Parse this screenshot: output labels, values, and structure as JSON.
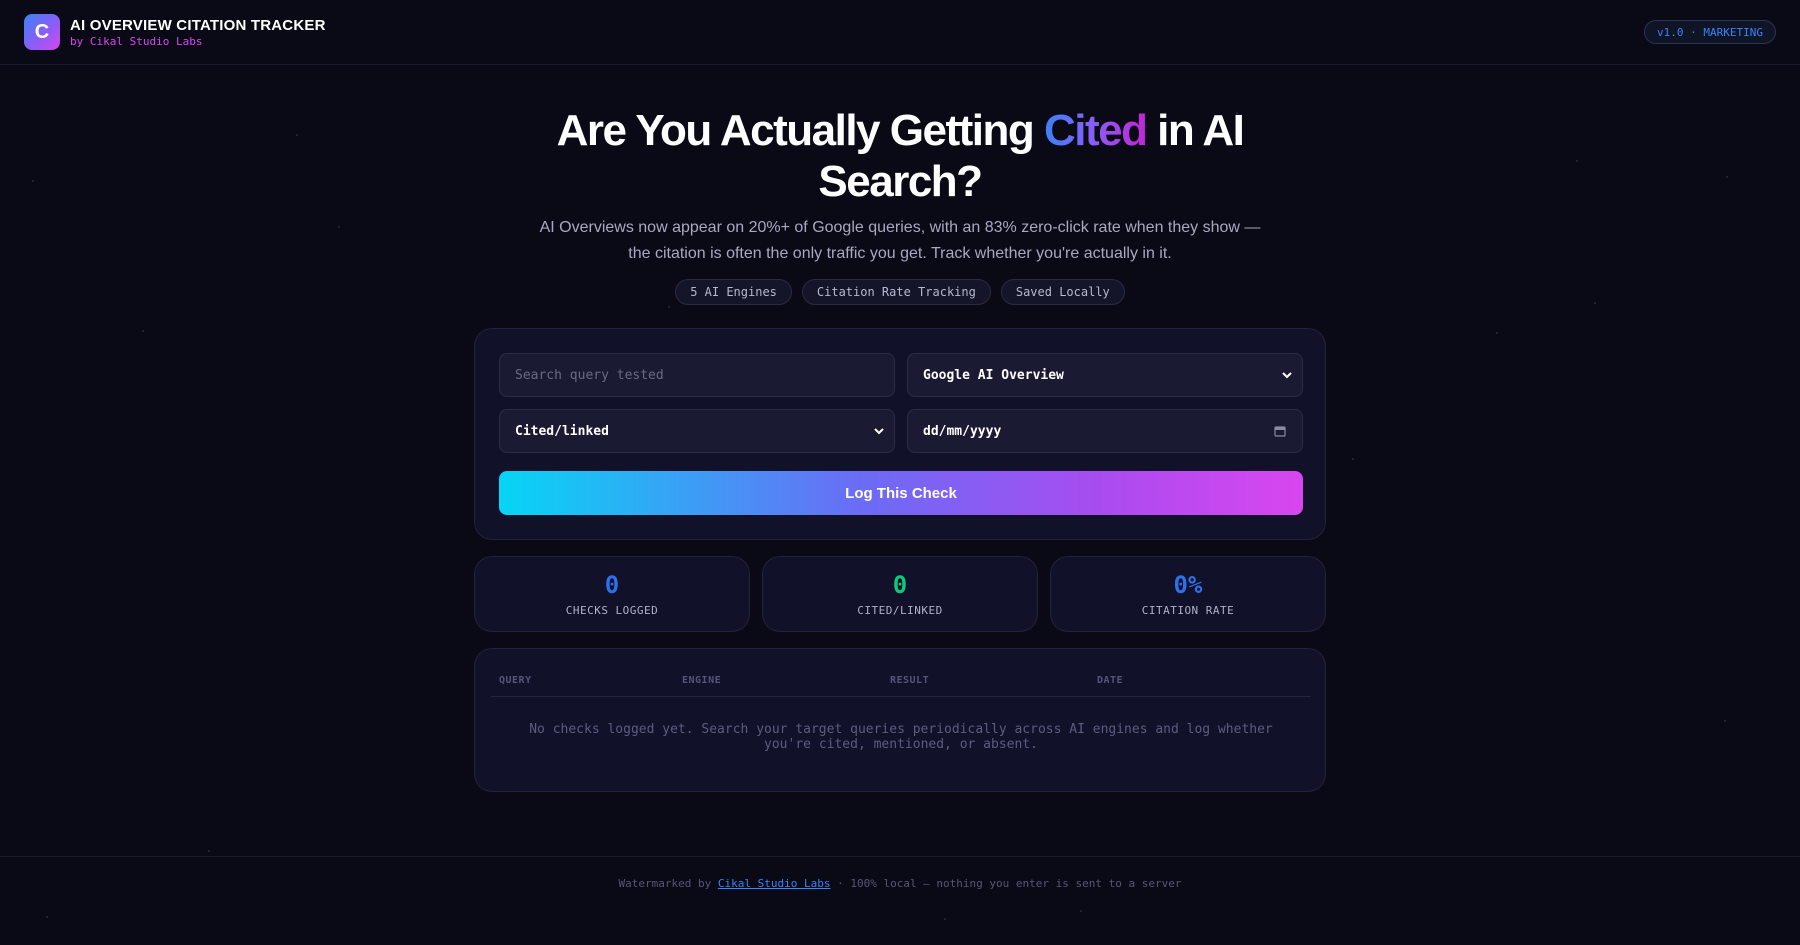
{
  "header": {
    "logo_letter": "C",
    "title": "AI OVERVIEW CITATION TRACKER",
    "subtitle": "by Cikal Studio Labs",
    "version_badge": "v1.0 · MARKETING"
  },
  "hero": {
    "title_part1": "Are You Actually Getting ",
    "title_highlight": "Cited",
    "title_part2": " in AI",
    "title_line2": "Search?",
    "description": "AI Overviews now appear on 20%+ of Google queries, with an 83% zero-click rate when they show — the citation is often the only traffic you get. Track whether you're actually in it.",
    "chips": [
      "5 AI Engines",
      "Citation Rate Tracking",
      "Saved Locally"
    ]
  },
  "form": {
    "query_placeholder": "Search query tested",
    "engine_selected": "Google AI Overview",
    "result_selected": "Cited/linked",
    "date_placeholder": "dd/mm/yyyy",
    "submit_label": "Log This Check"
  },
  "stats": [
    {
      "value": "0",
      "label": "CHECKS LOGGED",
      "color": "#2f6fe8"
    },
    {
      "value": "0",
      "label": "CITED/LINKED",
      "color": "#10c77a"
    },
    {
      "value": "0%",
      "label": "CITATION RATE",
      "color": "#2f6fe8"
    }
  ],
  "table": {
    "columns": [
      "QUERY",
      "ENGINE",
      "RESULT",
      "DATE"
    ],
    "empty_message": "No checks logged yet. Search your target queries periodically across AI engines and log whether you're cited, mentioned, or absent."
  },
  "footer": {
    "prefix": "Watermarked by ",
    "link_label": "Cikal Studio Labs",
    "suffix": " · 100% local — nothing you enter is sent to a server"
  },
  "colors": {
    "background": "#0a0a17",
    "accent_blue": "#3b82f6",
    "accent_magenta": "#d946ef",
    "accent_cyan": "#06d6f5"
  }
}
